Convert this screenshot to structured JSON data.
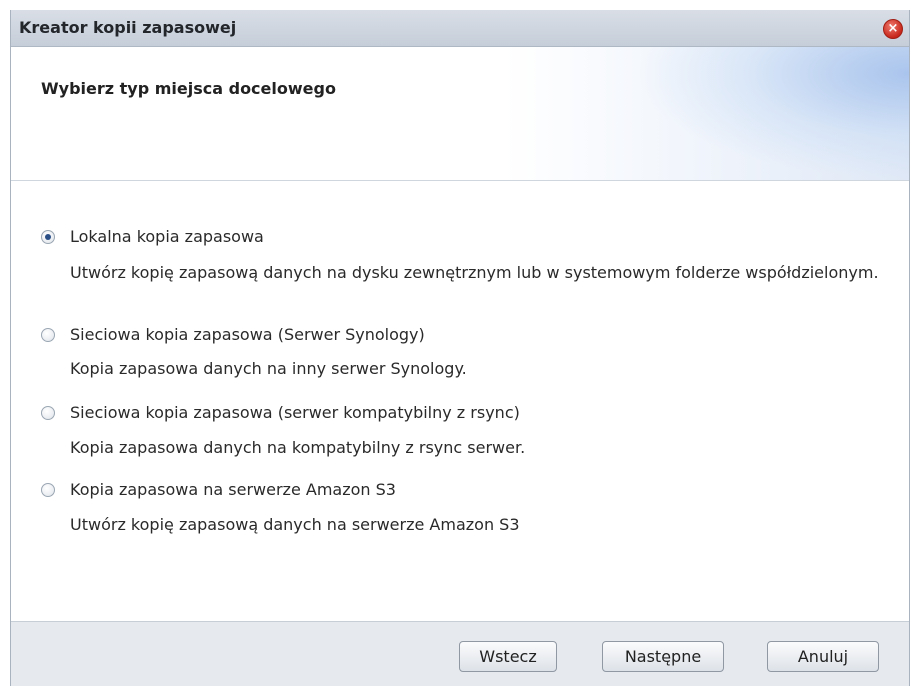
{
  "window": {
    "title": "Kreator kopii zapasowej",
    "close_icon": "close-icon"
  },
  "header": {
    "title": "Wybierz typ miejsca docelowego"
  },
  "options": [
    {
      "label": "Lokalna kopia zapasowa",
      "description": "Utwórz kopię zapasową danych na dysku zewnętrznym lub w systemowym folderze współdzielonym.",
      "selected": true
    },
    {
      "label": "Sieciowa kopia zapasowa (Serwer Synology)",
      "description": "Kopia zapasowa danych na inny serwer Synology.",
      "selected": false
    },
    {
      "label": "Sieciowa kopia zapasowa (serwer kompatybilny z rsync)",
      "description": "Kopia zapasowa danych na kompatybilny z rsync serwer.",
      "selected": false
    },
    {
      "label": "Kopia zapasowa na serwerze Amazon S3",
      "description": "Utwórz kopię zapasową danych na serwerze Amazon S3",
      "selected": false
    }
  ],
  "footer": {
    "back_label": "Wstecz",
    "next_label": "Następne",
    "cancel_label": "Anuluj"
  }
}
